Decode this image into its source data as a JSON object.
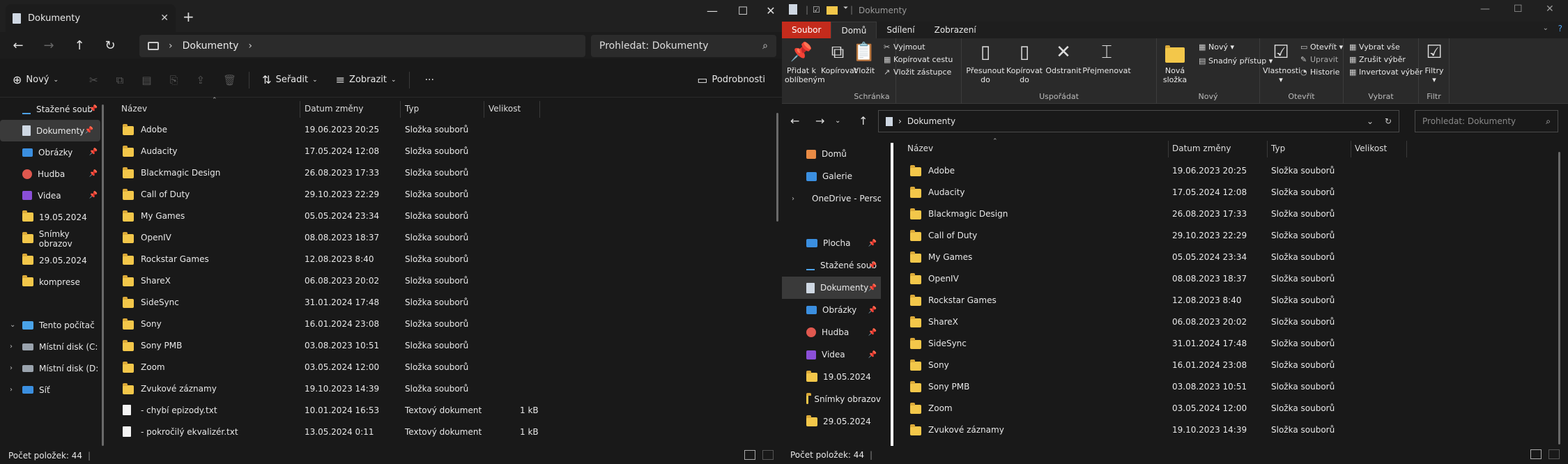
{
  "w1": {
    "tab_title": "Dokumenty",
    "close_tab": "✕",
    "new_tab": "+",
    "min": "—",
    "max": "☐",
    "close": "✕",
    "address": "Dokumenty",
    "search_placeholder": "Prohledat: Dokumenty",
    "cmd": {
      "new": "Nový",
      "sort": "Seřadit",
      "view": "Zobrazit",
      "more": "···",
      "details": "Podrobnosti"
    },
    "sidebar": [
      {
        "label": "Stažené soub",
        "icon": "download-icon",
        "pin": true
      },
      {
        "label": "Dokumenty",
        "icon": "document-icon",
        "pin": true,
        "selected": true
      },
      {
        "label": "Obrázky",
        "icon": "pictures-icon",
        "pin": true
      },
      {
        "label": "Hudba",
        "icon": "music-icon",
        "pin": true
      },
      {
        "label": "Videa",
        "icon": "video-icon",
        "pin": true
      },
      {
        "label": "19.05.2024",
        "icon": "folder-icon"
      },
      {
        "label": "Snímky obrazov",
        "icon": "folder-icon"
      },
      {
        "label": "29.05.2024",
        "icon": "folder-icon"
      },
      {
        "label": "komprese",
        "icon": "folder-icon"
      },
      {
        "label": "",
        "icon": ""
      },
      {
        "label": "Tento počítač",
        "icon": "pc-icon",
        "chev": "⌄"
      },
      {
        "label": "Místní disk (C:",
        "icon": "drive-icon",
        "chev": "›"
      },
      {
        "label": "Místní disk (D:",
        "icon": "drive-icon",
        "chev": "›"
      },
      {
        "label": "Síť",
        "icon": "network-icon",
        "chev": "›"
      }
    ],
    "columns": [
      "Název",
      "Datum změny",
      "Typ",
      "Velikost"
    ],
    "rows": [
      {
        "name": "Adobe",
        "date": "19.06.2023 20:25",
        "type": "Složka souborů",
        "size": "",
        "kind": "folder"
      },
      {
        "name": "Audacity",
        "date": "17.05.2024 12:08",
        "type": "Složka souborů",
        "size": "",
        "kind": "folder"
      },
      {
        "name": "Blackmagic Design",
        "date": "26.08.2023 17:33",
        "type": "Složka souborů",
        "size": "",
        "kind": "folder"
      },
      {
        "name": "Call of Duty",
        "date": "29.10.2023 22:29",
        "type": "Složka souborů",
        "size": "",
        "kind": "folder"
      },
      {
        "name": "My Games",
        "date": "05.05.2024 23:34",
        "type": "Složka souborů",
        "size": "",
        "kind": "folder"
      },
      {
        "name": "OpenIV",
        "date": "08.08.2023 18:37",
        "type": "Složka souborů",
        "size": "",
        "kind": "folder"
      },
      {
        "name": "Rockstar Games",
        "date": "12.08.2023 8:40",
        "type": "Složka souborů",
        "size": "",
        "kind": "folder"
      },
      {
        "name": "ShareX",
        "date": "06.08.2023 20:02",
        "type": "Složka souborů",
        "size": "",
        "kind": "folder"
      },
      {
        "name": "SideSync",
        "date": "31.01.2024 17:48",
        "type": "Složka souborů",
        "size": "",
        "kind": "folder"
      },
      {
        "name": "Sony",
        "date": "16.01.2024 23:08",
        "type": "Složka souborů",
        "size": "",
        "kind": "folder"
      },
      {
        "name": "Sony PMB",
        "date": "03.08.2023 10:51",
        "type": "Složka souborů",
        "size": "",
        "kind": "folder"
      },
      {
        "name": "Zoom",
        "date": "03.05.2024 12:00",
        "type": "Složka souborů",
        "size": "",
        "kind": "folder"
      },
      {
        "name": "Zvukové záznamy",
        "date": "19.10.2023 14:39",
        "type": "Složka souborů",
        "size": "",
        "kind": "folder"
      },
      {
        "name": "- chybí epizody.txt",
        "date": "10.01.2024 16:53",
        "type": "Textový dokument",
        "size": "1 kB",
        "kind": "txt"
      },
      {
        "name": "- pokročilý ekvalizér.txt",
        "date": "13.05.2024 0:11",
        "type": "Textový dokument",
        "size": "1 kB",
        "kind": "txt"
      }
    ],
    "status": "Počet položek: 44"
  },
  "w2": {
    "title": "Dokumenty",
    "ribbon_tabs": [
      "Soubor",
      "Domů",
      "Sdílení",
      "Zobrazení"
    ],
    "groups": {
      "clipboard": "Schránka",
      "organize": "Uspořádat",
      "new": "Nový",
      "open": "Otevřít",
      "select": "Vybrat",
      "filter": "Filtr"
    },
    "buttons": {
      "pin_a": "Přidat k",
      "pin_b": "oblíbeným",
      "copy": "Kopírovat",
      "paste": "Vložit",
      "cut": "Vyjmout",
      "copy_path": "Kopírovat cestu",
      "paste_shortcut": "Vložit zástupce",
      "move_a": "Přesunout",
      "move_b": "do",
      "copyto_a": "Kopírovat",
      "copyto_b": "do",
      "delete": "Odstranit",
      "rename": "Přejmenovat",
      "newfolder_a": "Nová",
      "newfolder_b": "složka",
      "new_item": "Nový",
      "easy_access": "Snadný přístup",
      "properties": "Vlastnosti",
      "open": "Otevřít",
      "edit": "Upravit",
      "history": "Historie",
      "select_all": "Vybrat vše",
      "select_none": "Zrušit výběr",
      "invert": "Invertovat výběr",
      "filters": "Filtry"
    },
    "address": "Dokumenty",
    "search_placeholder": "Prohledat: Dokumenty",
    "sidebar": [
      {
        "label": "Domů",
        "icon": "home-icon"
      },
      {
        "label": "Galerie",
        "icon": "gallery-icon"
      },
      {
        "label": "OneDrive - Perso",
        "icon": "cloud-icon",
        "chev": "›"
      },
      {
        "label": "",
        "icon": ""
      },
      {
        "label": "Plocha",
        "icon": "desktop-icon",
        "pin": true
      },
      {
        "label": "Stažené soub",
        "icon": "download-icon",
        "pin": true
      },
      {
        "label": "Dokumenty",
        "icon": "document-icon",
        "pin": true,
        "selected": true
      },
      {
        "label": "Obrázky",
        "icon": "pictures-icon",
        "pin": true
      },
      {
        "label": "Hudba",
        "icon": "music-icon",
        "pin": true
      },
      {
        "label": "Videa",
        "icon": "video-icon",
        "pin": true
      },
      {
        "label": "19.05.2024",
        "icon": "folder-icon"
      },
      {
        "label": "Snímky obrazov",
        "icon": "folder-icon"
      },
      {
        "label": "29.05.2024",
        "icon": "folder-icon"
      }
    ],
    "columns": [
      "Název",
      "Datum změny",
      "Typ",
      "Velikost"
    ],
    "rows": [
      {
        "name": "Adobe",
        "date": "19.06.2023 20:25",
        "type": "Složka souborů"
      },
      {
        "name": "Audacity",
        "date": "17.05.2024 12:08",
        "type": "Složka souborů"
      },
      {
        "name": "Blackmagic Design",
        "date": "26.08.2023 17:33",
        "type": "Složka souborů"
      },
      {
        "name": "Call of Duty",
        "date": "29.10.2023 22:29",
        "type": "Složka souborů"
      },
      {
        "name": "My Games",
        "date": "05.05.2024 23:34",
        "type": "Složka souborů"
      },
      {
        "name": "OpenIV",
        "date": "08.08.2023 18:37",
        "type": "Složka souborů"
      },
      {
        "name": "Rockstar Games",
        "date": "12.08.2023 8:40",
        "type": "Složka souborů"
      },
      {
        "name": "ShareX",
        "date": "06.08.2023 20:02",
        "type": "Složka souborů"
      },
      {
        "name": "SideSync",
        "date": "31.01.2024 17:48",
        "type": "Složka souborů"
      },
      {
        "name": "Sony",
        "date": "16.01.2024 23:08",
        "type": "Složka souborů"
      },
      {
        "name": "Sony PMB",
        "date": "03.08.2023 10:51",
        "type": "Složka souborů"
      },
      {
        "name": "Zoom",
        "date": "03.05.2024 12:00",
        "type": "Složka souborů"
      },
      {
        "name": "Zvukové záznamy",
        "date": "19.10.2023 14:39",
        "type": "Složka souborů"
      }
    ],
    "status": "Počet položek: 44"
  }
}
